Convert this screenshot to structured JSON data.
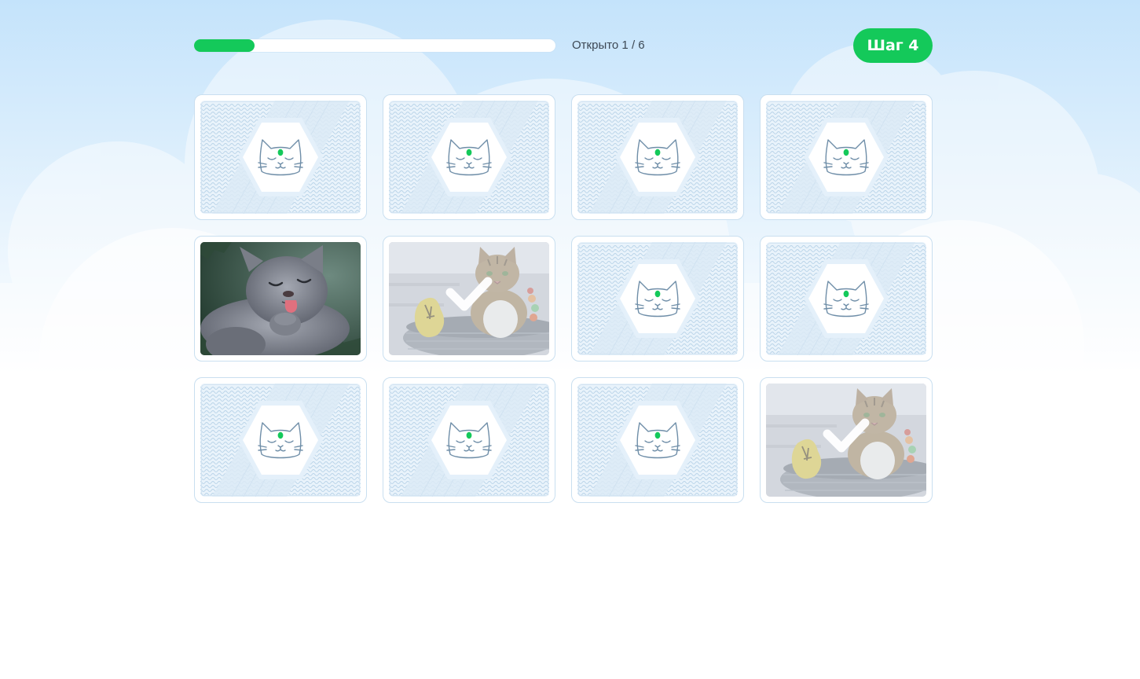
{
  "progress": {
    "label": "Открыто 1 / 6",
    "opened": 1,
    "total": 6
  },
  "step_badge": {
    "label": "Шаг 4"
  },
  "colors": {
    "accent": "#14c95a",
    "card_border": "#c9dff0",
    "card_back_pattern": "#a9c8e2",
    "sky_top": "#c4e3fb"
  },
  "cards": [
    {
      "state": "back",
      "icon": "sleeping-cat-icon"
    },
    {
      "state": "back",
      "icon": "sleeping-cat-icon"
    },
    {
      "state": "back",
      "icon": "sleeping-cat-icon"
    },
    {
      "state": "back",
      "icon": "sleeping-cat-icon"
    },
    {
      "state": "open",
      "image": "gray-cat-licking-paw"
    },
    {
      "state": "matched",
      "image": "tabby-cat-in-basket",
      "icon": "check-icon"
    },
    {
      "state": "back",
      "icon": "sleeping-cat-icon"
    },
    {
      "state": "back",
      "icon": "sleeping-cat-icon"
    },
    {
      "state": "back",
      "icon": "sleeping-cat-icon"
    },
    {
      "state": "back",
      "icon": "sleeping-cat-icon"
    },
    {
      "state": "back",
      "icon": "sleeping-cat-icon"
    },
    {
      "state": "matched",
      "image": "tabby-cat-in-basket",
      "icon": "check-icon"
    }
  ]
}
